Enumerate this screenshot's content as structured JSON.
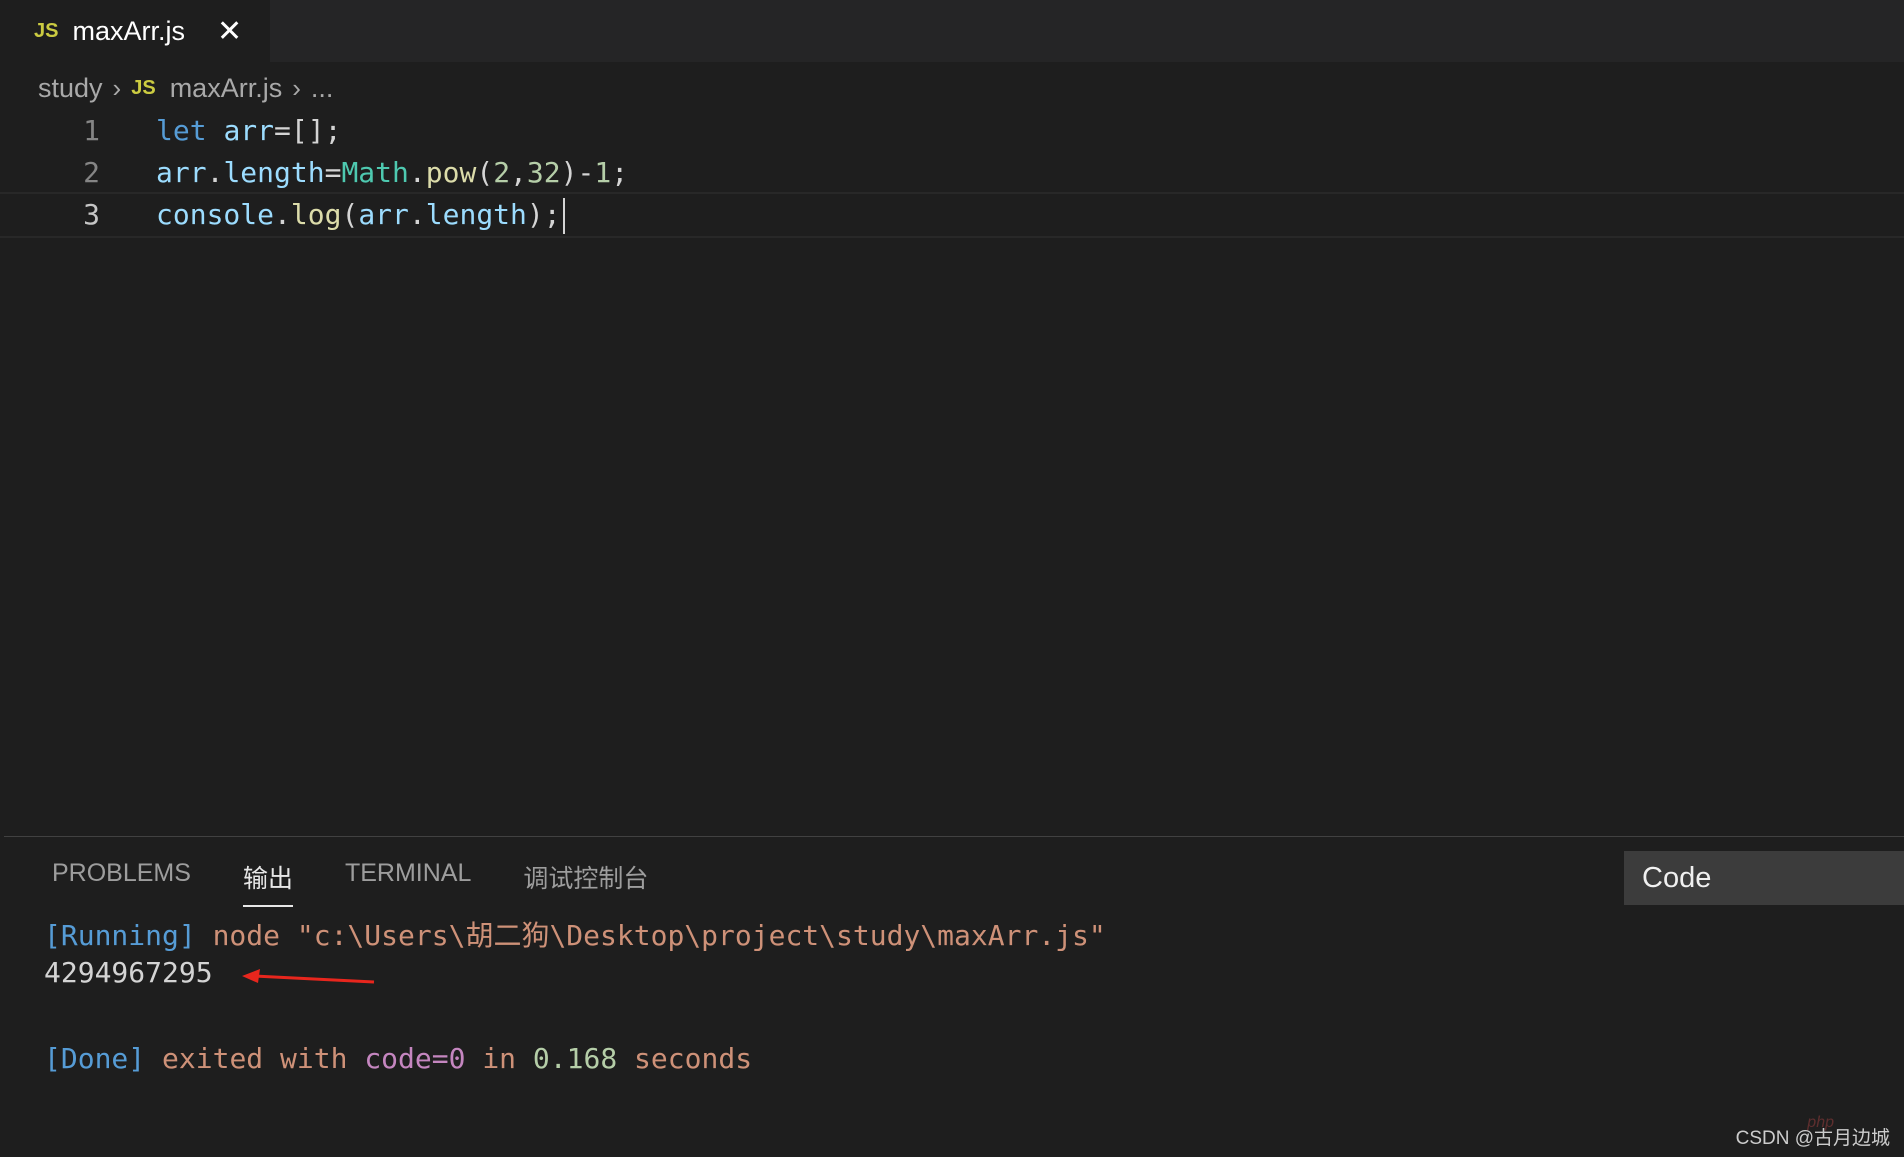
{
  "tab": {
    "icon": "JS",
    "filename": "maxArr.js",
    "close_icon": "✕"
  },
  "breadcrumb": {
    "folder": "study",
    "icon": "JS",
    "file": "maxArr.js",
    "more": "..."
  },
  "editor": {
    "line_numbers": [
      "1",
      "2",
      "3"
    ],
    "lines": [
      [
        [
          "kw",
          "let"
        ],
        [
          "pun",
          " "
        ],
        [
          "var",
          "arr"
        ],
        [
          "pun",
          "=[];"
        ]
      ],
      [
        [
          "var",
          "arr"
        ],
        [
          "pun",
          "."
        ],
        [
          "var",
          "length"
        ],
        [
          "pun",
          "="
        ],
        [
          "cls",
          "Math"
        ],
        [
          "pun",
          "."
        ],
        [
          "fn",
          "pow"
        ],
        [
          "pun",
          "("
        ],
        [
          "num",
          "2"
        ],
        [
          "pun",
          ","
        ],
        [
          "num",
          "32"
        ],
        [
          "pun",
          ")-"
        ],
        [
          "num",
          "1"
        ],
        [
          "pun",
          ";"
        ]
      ],
      [
        [
          "var",
          "console"
        ],
        [
          "pun",
          "."
        ],
        [
          "fn",
          "log"
        ],
        [
          "pun",
          "("
        ],
        [
          "var",
          "arr"
        ],
        [
          "pun",
          "."
        ],
        [
          "var",
          "length"
        ],
        [
          "pun",
          ");"
        ]
      ]
    ]
  },
  "panel": {
    "tabs": [
      "PROBLEMS",
      "输出",
      "TERMINAL",
      "调试控制台"
    ],
    "active_tab": "输出",
    "channel": "Code",
    "output": {
      "running_tag": "[Running]",
      "running_cmd": " node \"c:\\Users\\胡二狗\\Desktop\\project\\study\\maxArr.js\"",
      "result": "4294967295",
      "done_tag": "[Done]",
      "done_text1": " exited with ",
      "done_code": "code=0",
      "done_text2": " in ",
      "done_time": "0.168",
      "done_text3": " seconds"
    }
  },
  "watermark": {
    "text": "CSDN @古月边城",
    "php": "php"
  },
  "colors": {
    "arrow": "#e8261d"
  }
}
